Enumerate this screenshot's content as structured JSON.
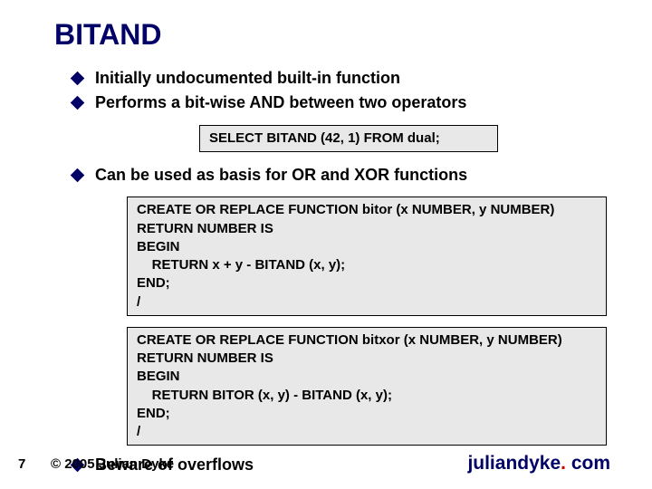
{
  "title": "BITAND",
  "bullets": {
    "b1": "Initially undocumented built-in function",
    "b2": "Performs a bit-wise AND between two operators",
    "b3": "Can be used as basis for OR and XOR functions",
    "b4": "Beware of overflows"
  },
  "code": {
    "select": "SELECT BITAND (42, 1) FROM dual;",
    "bitor": "CREATE OR REPLACE FUNCTION bitor (x NUMBER, y NUMBER)\nRETURN NUMBER IS\nBEGIN\n    RETURN x + y - BITAND (x, y);\nEND;\n/",
    "bitxor": "CREATE OR REPLACE FUNCTION bitxor (x NUMBER, y NUMBER)\nRETURN NUMBER IS\nBEGIN\n    RETURN BITOR (x, y) - BITAND (x, y);\nEND;\n/"
  },
  "footer": {
    "page": "7",
    "copyright": "© 2005 Julian Dyke",
    "brand_name": "juliandyke",
    "brand_dot": ". ",
    "brand_tld": "com"
  }
}
